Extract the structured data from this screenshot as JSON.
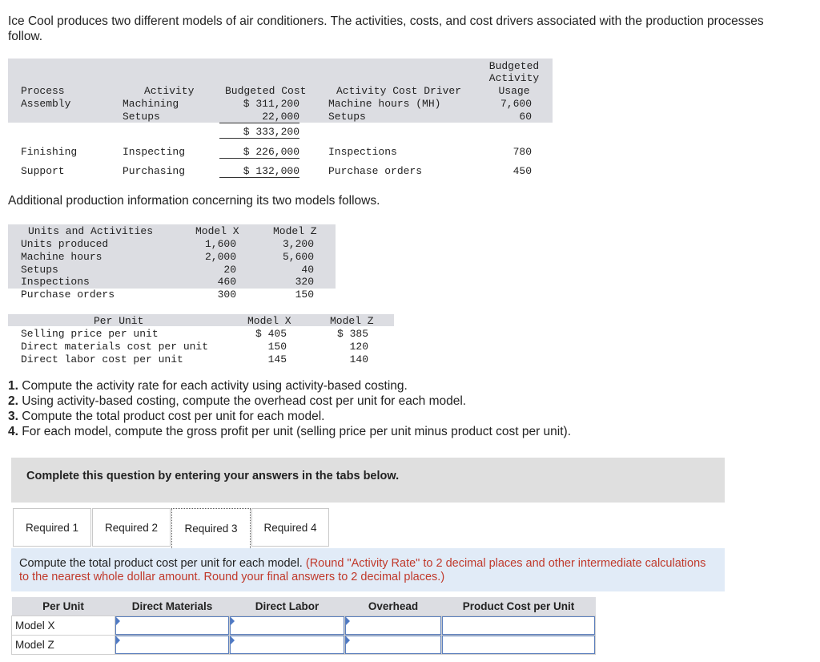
{
  "intro": "Ice Cool produces two different models of air conditioners. The activities, costs, and cost drivers associated with the production processes follow.",
  "activity_table": {
    "headers": {
      "process": "Process",
      "activity": "Activity",
      "budgeted_cost": "Budgeted Cost",
      "driver": "Activity Cost Driver",
      "usage_line1": "Budgeted",
      "usage_line2": "Activity",
      "usage_line3": "Usage"
    },
    "assembly": {
      "process": "Assembly",
      "activity1": "Machining",
      "cost1": "$ 311,200",
      "driver1": "Machine hours (MH)",
      "usage1": "7,600",
      "activity2": "Setups",
      "cost2": "22,000",
      "driver2": "Setups",
      "usage2": "60",
      "total": "$ 333,200"
    },
    "finishing": {
      "process": "Finishing",
      "activity": "Inspecting",
      "cost": "$ 226,000",
      "driver": "Inspections",
      "usage": "780"
    },
    "support": {
      "process": "Support",
      "activity": "Purchasing",
      "cost": "$ 132,000",
      "driver": "Purchase orders",
      "usage": "450"
    }
  },
  "additional_text": "Additional production information concerning its two models follows.",
  "units_table": {
    "header": "Units and Activities",
    "model_x": "Model X",
    "model_z": "Model Z",
    "rows": [
      {
        "label": "Units produced",
        "x": "1,600",
        "z": "3,200"
      },
      {
        "label": "Machine hours",
        "x": "2,000",
        "z": "5,600"
      },
      {
        "label": "Setups",
        "x": "20",
        "z": "40"
      },
      {
        "label": "Inspections",
        "x": "460",
        "z": "320"
      },
      {
        "label": "Purchase orders",
        "x": "300",
        "z": "150"
      }
    ]
  },
  "per_unit_table": {
    "header": "Per Unit",
    "model_x": "Model X",
    "model_z": "Model Z",
    "rows": [
      {
        "label": "Selling price per unit",
        "x": "$ 405",
        "z": "$ 385"
      },
      {
        "label": "Direct materials cost per unit",
        "x": "150",
        "z": "120"
      },
      {
        "label": "Direct labor cost per unit",
        "x": "145",
        "z": "140"
      }
    ]
  },
  "questions": [
    {
      "num": "1.",
      "text": " Compute the activity rate for each activity using activity-based costing."
    },
    {
      "num": "2.",
      "text": " Using activity-based costing, compute the overhead cost per unit for each model."
    },
    {
      "num": "3.",
      "text": " Compute the total product cost per unit for each model."
    },
    {
      "num": "4.",
      "text": " For each model, compute the gross profit per unit (selling price per unit minus product cost per unit)."
    }
  ],
  "panel_text": "Complete this question by entering your answers in the tabs below.",
  "tabs": [
    "Required 1",
    "Required 2",
    "Required 3",
    "Required 4"
  ],
  "active_tab": "Required 3",
  "instruction": {
    "main": "Compute the total product cost per unit for each model.",
    "note": "(Round \"Activity Rate\" to 2 decimal places and other intermediate calculations to the nearest whole dollar amount. Round your final answers to 2 decimal places.)"
  },
  "answer_table": {
    "headers": [
      "Per Unit",
      "Direct Materials",
      "Direct Labor",
      "Overhead",
      "Product Cost per Unit"
    ],
    "rows": [
      "Model X",
      "Model Z"
    ]
  }
}
